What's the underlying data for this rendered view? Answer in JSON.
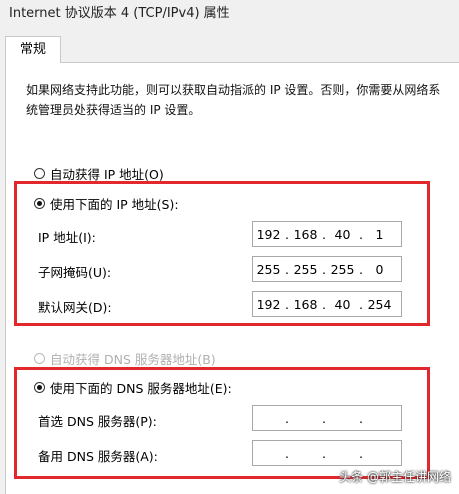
{
  "window": {
    "title": "Internet 协议版本 4 (TCP/IPv4) 属性"
  },
  "tabs": [
    {
      "label": "常规"
    }
  ],
  "description": "如果网络支持此功能，则可以获取自动指派的 IP 设置。否则，你需要从网络系统管理员处获得适当的 IP 设置。",
  "ip": {
    "auto_label": "自动获得 IP 地址(O)",
    "manual_label": "使用下面的 IP 地址(S):",
    "fields": [
      {
        "label": "IP 地址(I):",
        "octets": [
          "192",
          "168",
          "40",
          "1"
        ]
      },
      {
        "label": "子网掩码(U):",
        "octets": [
          "255",
          "255",
          "255",
          "0"
        ]
      },
      {
        "label": "默认网关(D):",
        "octets": [
          "192",
          "168",
          "40",
          "254"
        ]
      }
    ]
  },
  "dns": {
    "auto_label": "自动获得 DNS 服务器地址(B)",
    "manual_label": "使用下面的 DNS 服务器地址(E):",
    "fields": [
      {
        "label": "首选 DNS 服务器(P):",
        "octets": [
          "",
          "",
          "",
          ""
        ]
      },
      {
        "label": "备用 DNS 服务器(A):",
        "octets": [
          "",
          "",
          "",
          ""
        ]
      }
    ]
  },
  "watermark": "头条 @郭主任讲网络",
  "colors": {
    "highlight": "#e0282d"
  }
}
